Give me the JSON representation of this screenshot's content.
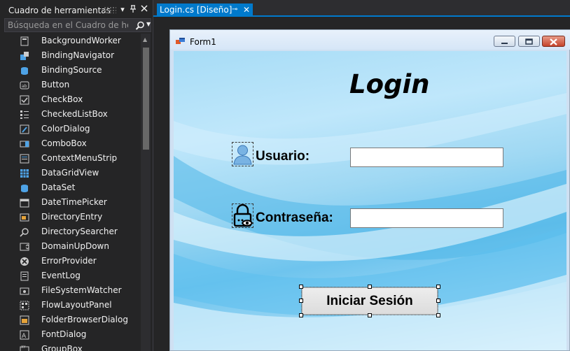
{
  "toolbox": {
    "title": "Cuadro de herramientas",
    "dropdown_icon": "chevron-down-icon",
    "pin_icon": "pin-icon",
    "close_icon": "close-icon",
    "search": {
      "placeholder": "Búsqueda en el Cuadro de herramientas",
      "icon": "search-icon"
    },
    "items": [
      {
        "label": "BackgroundWorker",
        "icon": "backgroundworker-icon"
      },
      {
        "label": "BindingNavigator",
        "icon": "bindingnavigator-icon"
      },
      {
        "label": "BindingSource",
        "icon": "bindingsource-icon"
      },
      {
        "label": "Button",
        "icon": "button-icon"
      },
      {
        "label": "CheckBox",
        "icon": "checkbox-icon"
      },
      {
        "label": "CheckedListBox",
        "icon": "checkedlistbox-icon"
      },
      {
        "label": "ColorDialog",
        "icon": "colordialog-icon"
      },
      {
        "label": "ComboBox",
        "icon": "combobox-icon"
      },
      {
        "label": "ContextMenuStrip",
        "icon": "contextmenustrip-icon"
      },
      {
        "label": "DataGridView",
        "icon": "datagridview-icon"
      },
      {
        "label": "DataSet",
        "icon": "dataset-icon"
      },
      {
        "label": "DateTimePicker",
        "icon": "datetimepicker-icon"
      },
      {
        "label": "DirectoryEntry",
        "icon": "directoryentry-icon"
      },
      {
        "label": "DirectorySearcher",
        "icon": "directorysearcher-icon"
      },
      {
        "label": "DomainUpDown",
        "icon": "domainupdown-icon"
      },
      {
        "label": "ErrorProvider",
        "icon": "errorprovider-icon"
      },
      {
        "label": "EventLog",
        "icon": "eventlog-icon"
      },
      {
        "label": "FileSystemWatcher",
        "icon": "filesystemwatcher-icon"
      },
      {
        "label": "FlowLayoutPanel",
        "icon": "flowlayoutpanel-icon"
      },
      {
        "label": "FolderBrowserDialog",
        "icon": "folderbrowserdialog-icon"
      },
      {
        "label": "FontDialog",
        "icon": "fontdialog-icon"
      },
      {
        "label": "GroupBox",
        "icon": "groupbox-icon"
      }
    ]
  },
  "editor": {
    "tab": {
      "label": "Login.cs [Diseño]",
      "pin_icon": "pin-icon",
      "close_icon": "close-icon"
    }
  },
  "form": {
    "caption": "Form1",
    "title": "Login",
    "user_label": "Usuario:",
    "pass_label": "Contraseña:",
    "user_value": "",
    "pass_value": "",
    "button_label": "Iniciar Sesión",
    "user_icon": "user-icon",
    "pass_icon": "lock-eye-icon"
  },
  "colors": {
    "accent": "#007acc",
    "panel": "#252526",
    "text": "#f1f1f1"
  }
}
